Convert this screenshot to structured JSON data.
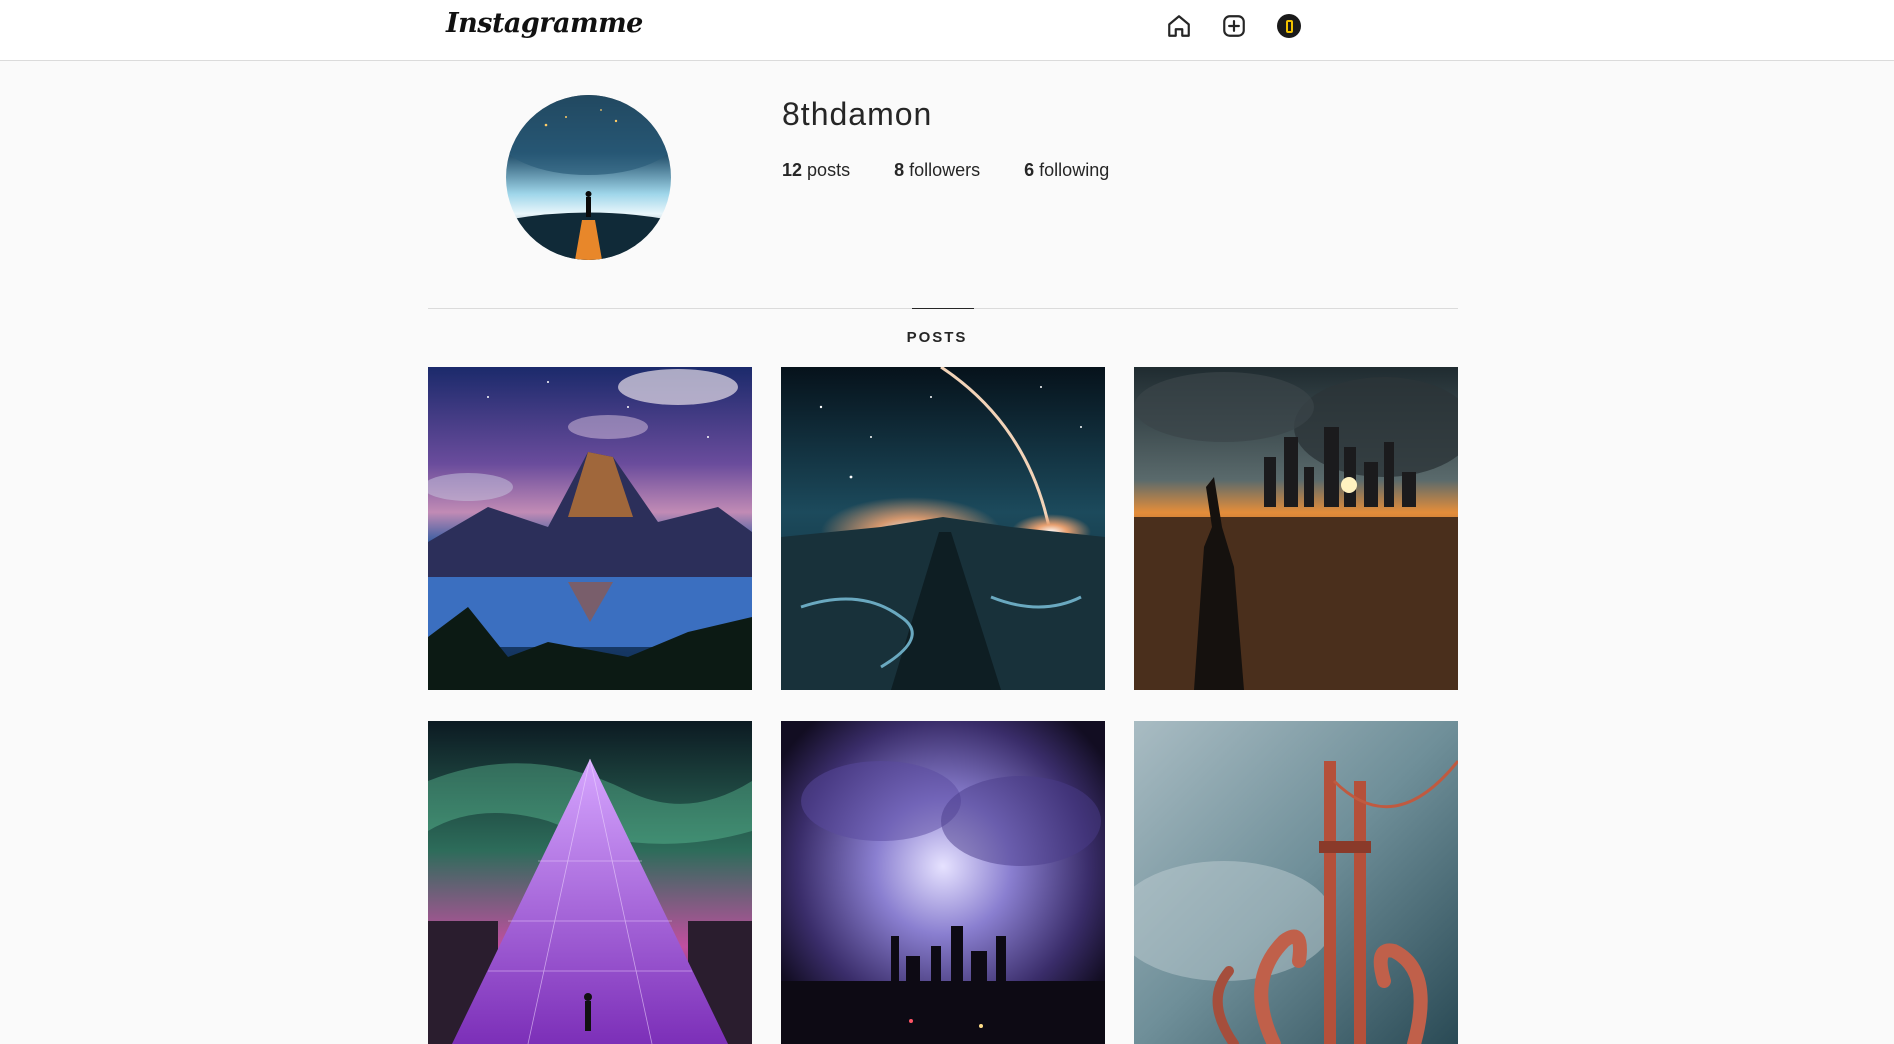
{
  "app": {
    "logo": "Instagramme"
  },
  "nav": {
    "icons": [
      "home-icon",
      "add-post-icon",
      "profile-avatar-icon"
    ]
  },
  "profile": {
    "username": "8thdamon",
    "posts_count": "12",
    "posts_label": "posts",
    "followers_count": "8",
    "followers_label": "followers",
    "following_count": "6",
    "following_label": "following"
  },
  "tabs": {
    "posts_label": "POSTS"
  },
  "colors": {
    "border": "#dbdbdb",
    "text": "#262626",
    "background": "#fafafa"
  }
}
